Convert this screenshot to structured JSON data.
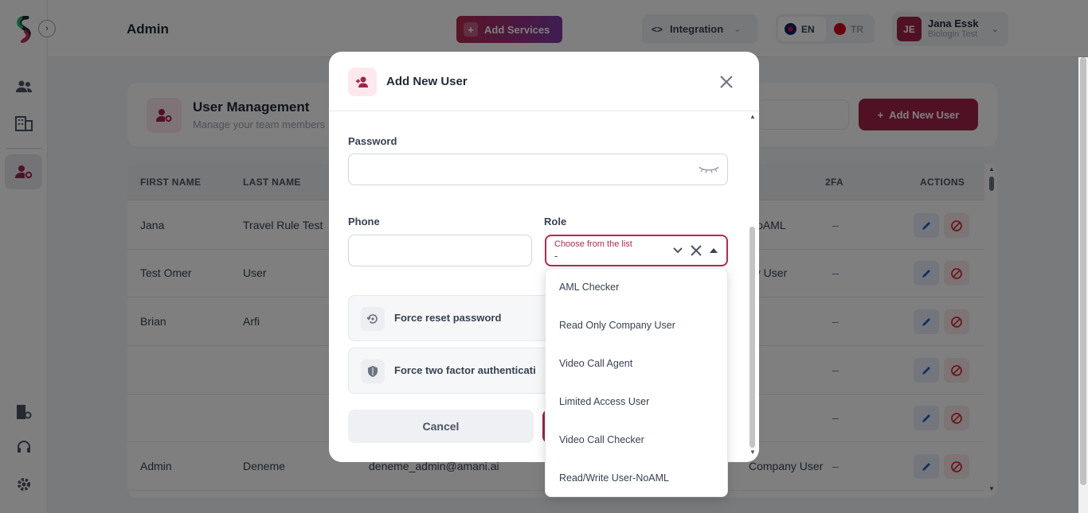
{
  "header": {
    "page_title": "Admin",
    "add_services_label": "Add Services",
    "integration_label": "Integration",
    "lang_en": "EN",
    "lang_tr": "TR",
    "user_initials": "JE",
    "user_name": "Jana Essk",
    "user_org": "Biologin Test"
  },
  "management": {
    "title": "User Management",
    "subtitle": "Manage your team members",
    "add_user_label": "Add New User"
  },
  "table": {
    "columns": [
      "FIRST NAME",
      "LAST NAME",
      "2FA",
      "ACTIONS"
    ],
    "rows": [
      {
        "first": "Jana",
        "last": "Travel Rule Test",
        "email": "",
        "role": "NoAML",
        "twofa": "–"
      },
      {
        "first": "Test Omer",
        "last": "User",
        "email": "",
        "role": "ny User",
        "twofa": "–"
      },
      {
        "first": "Brian",
        "last": "Arfi",
        "email": "",
        "role": "",
        "twofa": "–"
      },
      {
        "first": "",
        "last": "",
        "email": "",
        "role": "",
        "twofa": "–"
      },
      {
        "first": "",
        "last": "",
        "email": "",
        "role": "",
        "twofa": "–"
      },
      {
        "first": "Admin",
        "last": "Deneme",
        "email": "deneme_admin@amani.ai",
        "role": "Company User",
        "twofa": "–"
      }
    ]
  },
  "modal": {
    "title": "Add New User",
    "password_label": "Password",
    "phone_label": "Phone",
    "role_label": "Role",
    "role_placeholder": "Choose from the list",
    "role_value": "-",
    "force_reset_label": "Force reset password",
    "force_2fa_label": "Force two factor authenticati",
    "cancel_label": "Cancel",
    "role_options": [
      "AML Checker",
      "Read Only Company User",
      "Video Call Agent",
      "Limited Access User",
      "Video Call Checker",
      "Read/Write User-NoAML"
    ]
  },
  "colors": {
    "primary": "#a3224a",
    "accent": "#b5294e"
  }
}
